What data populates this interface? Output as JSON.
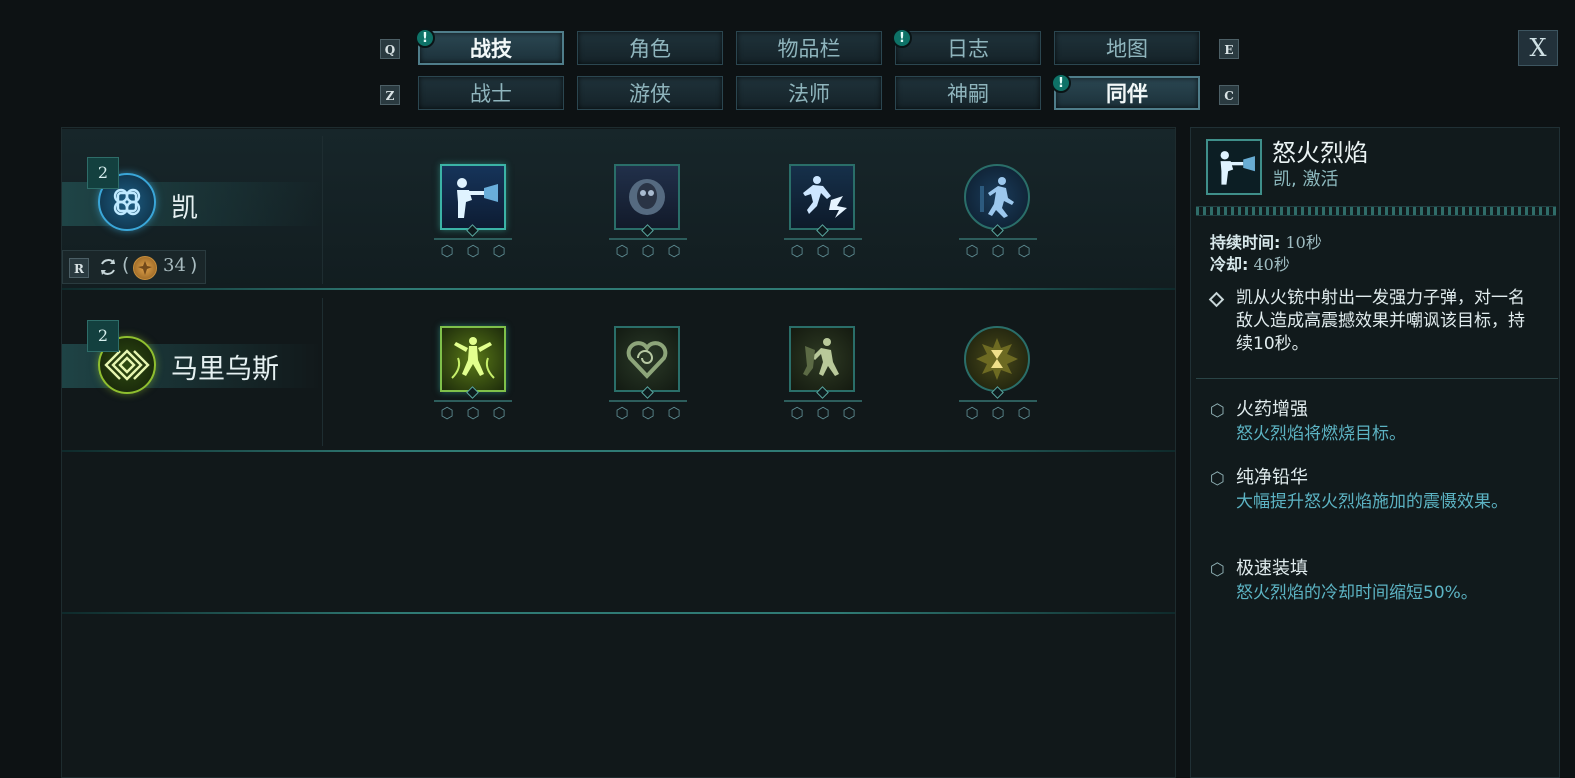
{
  "tabs_top": [
    {
      "key": "Q"
    },
    {
      "label": "战技",
      "active": true,
      "alert": true
    },
    {
      "label": "角色",
      "active": false,
      "alert": false
    },
    {
      "label": "物品栏",
      "active": false,
      "alert": false
    },
    {
      "label": "日志",
      "active": false,
      "alert": true
    },
    {
      "label": "地图",
      "active": false,
      "alert": false
    },
    {
      "key": "E"
    }
  ],
  "tabs_bottom": [
    {
      "key": "Z"
    },
    {
      "label": "战士",
      "active": false,
      "alert": false
    },
    {
      "label": "游侠",
      "active": false,
      "alert": false
    },
    {
      "label": "法师",
      "active": false,
      "alert": false
    },
    {
      "label": "神嗣",
      "active": false,
      "alert": false
    },
    {
      "label": "同伴",
      "active": true,
      "alert": true
    },
    {
      "key": "C"
    }
  ],
  "keys": {
    "q": "Q",
    "e": "E",
    "z": "Z",
    "c": "C",
    "r": "R"
  },
  "alert_glyph": "!",
  "close_label": "X",
  "characters": [
    {
      "name": "凯",
      "level": "2",
      "emblem_icon": "knot-emblem-icon",
      "resource": "34",
      "abilities": [
        "fire-shot-icon",
        "skull-mask-icon",
        "lightning-dash-icon",
        "runner-icon"
      ]
    },
    {
      "name": "马里乌斯",
      "level": "2",
      "emblem_icon": "diamond-emblem-icon",
      "abilities": [
        "vine-figure-icon",
        "heart-spiral-icon",
        "charging-figure-icon",
        "hourglass-burst-icon"
      ]
    }
  ],
  "resource_parens": {
    "open": "(",
    "close": ")"
  },
  "detail": {
    "title": "怒火烈焰",
    "subtitle": "凯, 激活",
    "duration_label": "持续时间:",
    "duration_value": "10秒",
    "cooldown_label": "冷却:",
    "cooldown_value": "40秒",
    "description": "凯从火铳中射出一发强力子弹，对一名敌人造成高震撼效果并嘲讽该目标，持续10秒。",
    "upgrades": [
      {
        "name": "火药增强",
        "desc": "怒火烈焰将燃烧目标。"
      },
      {
        "name": "纯净铅华",
        "desc": "大幅提升怒火烈焰施加的震慑效果。"
      },
      {
        "name": "极速装填",
        "desc": "怒火烈焰的冷却时间缩短50%。"
      }
    ]
  },
  "colors": {
    "background": "#0d1214",
    "accent_teal": "#3bb3a6",
    "upgrade_text": "#5cb3c3",
    "alert_green": "#0e7267"
  }
}
